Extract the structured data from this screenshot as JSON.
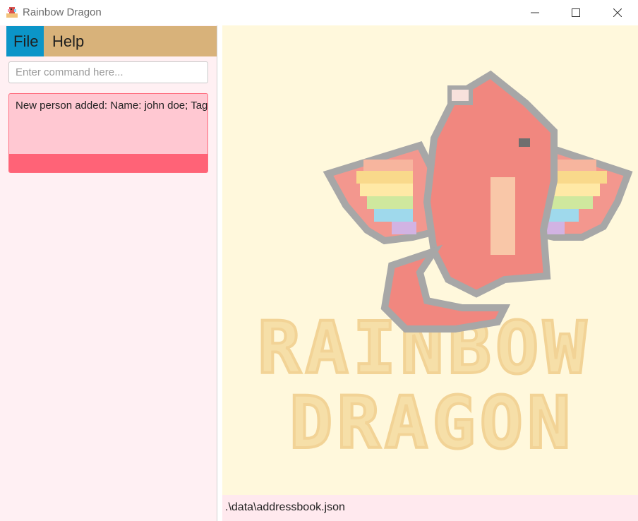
{
  "window": {
    "title": "Rainbow Dragon"
  },
  "menu": {
    "file_label": "File",
    "help_label": "Help"
  },
  "command": {
    "placeholder": "Enter command here...",
    "value": ""
  },
  "result": {
    "text": "New person added: Name: john doe; Tags:"
  },
  "logo": {
    "line1": "RAINBOW",
    "line2": "DRAGON"
  },
  "status": {
    "path": ".\\data\\addressbook.json"
  },
  "colors": {
    "menubar": "#d8b27a",
    "menu_selected": "#0b95c8",
    "left_pane_bg": "#fff0f3",
    "result_bg": "#ffc8d2",
    "result_border": "#ff6b7d",
    "scrollbar": "#ff6377",
    "right_pane_bg": "#fff8dc",
    "logo_text": "#f6dfa8"
  },
  "icons": {
    "app": "dragon-app-icon",
    "minimize": "minimize-icon",
    "maximize": "maximize-icon",
    "close": "close-icon"
  }
}
